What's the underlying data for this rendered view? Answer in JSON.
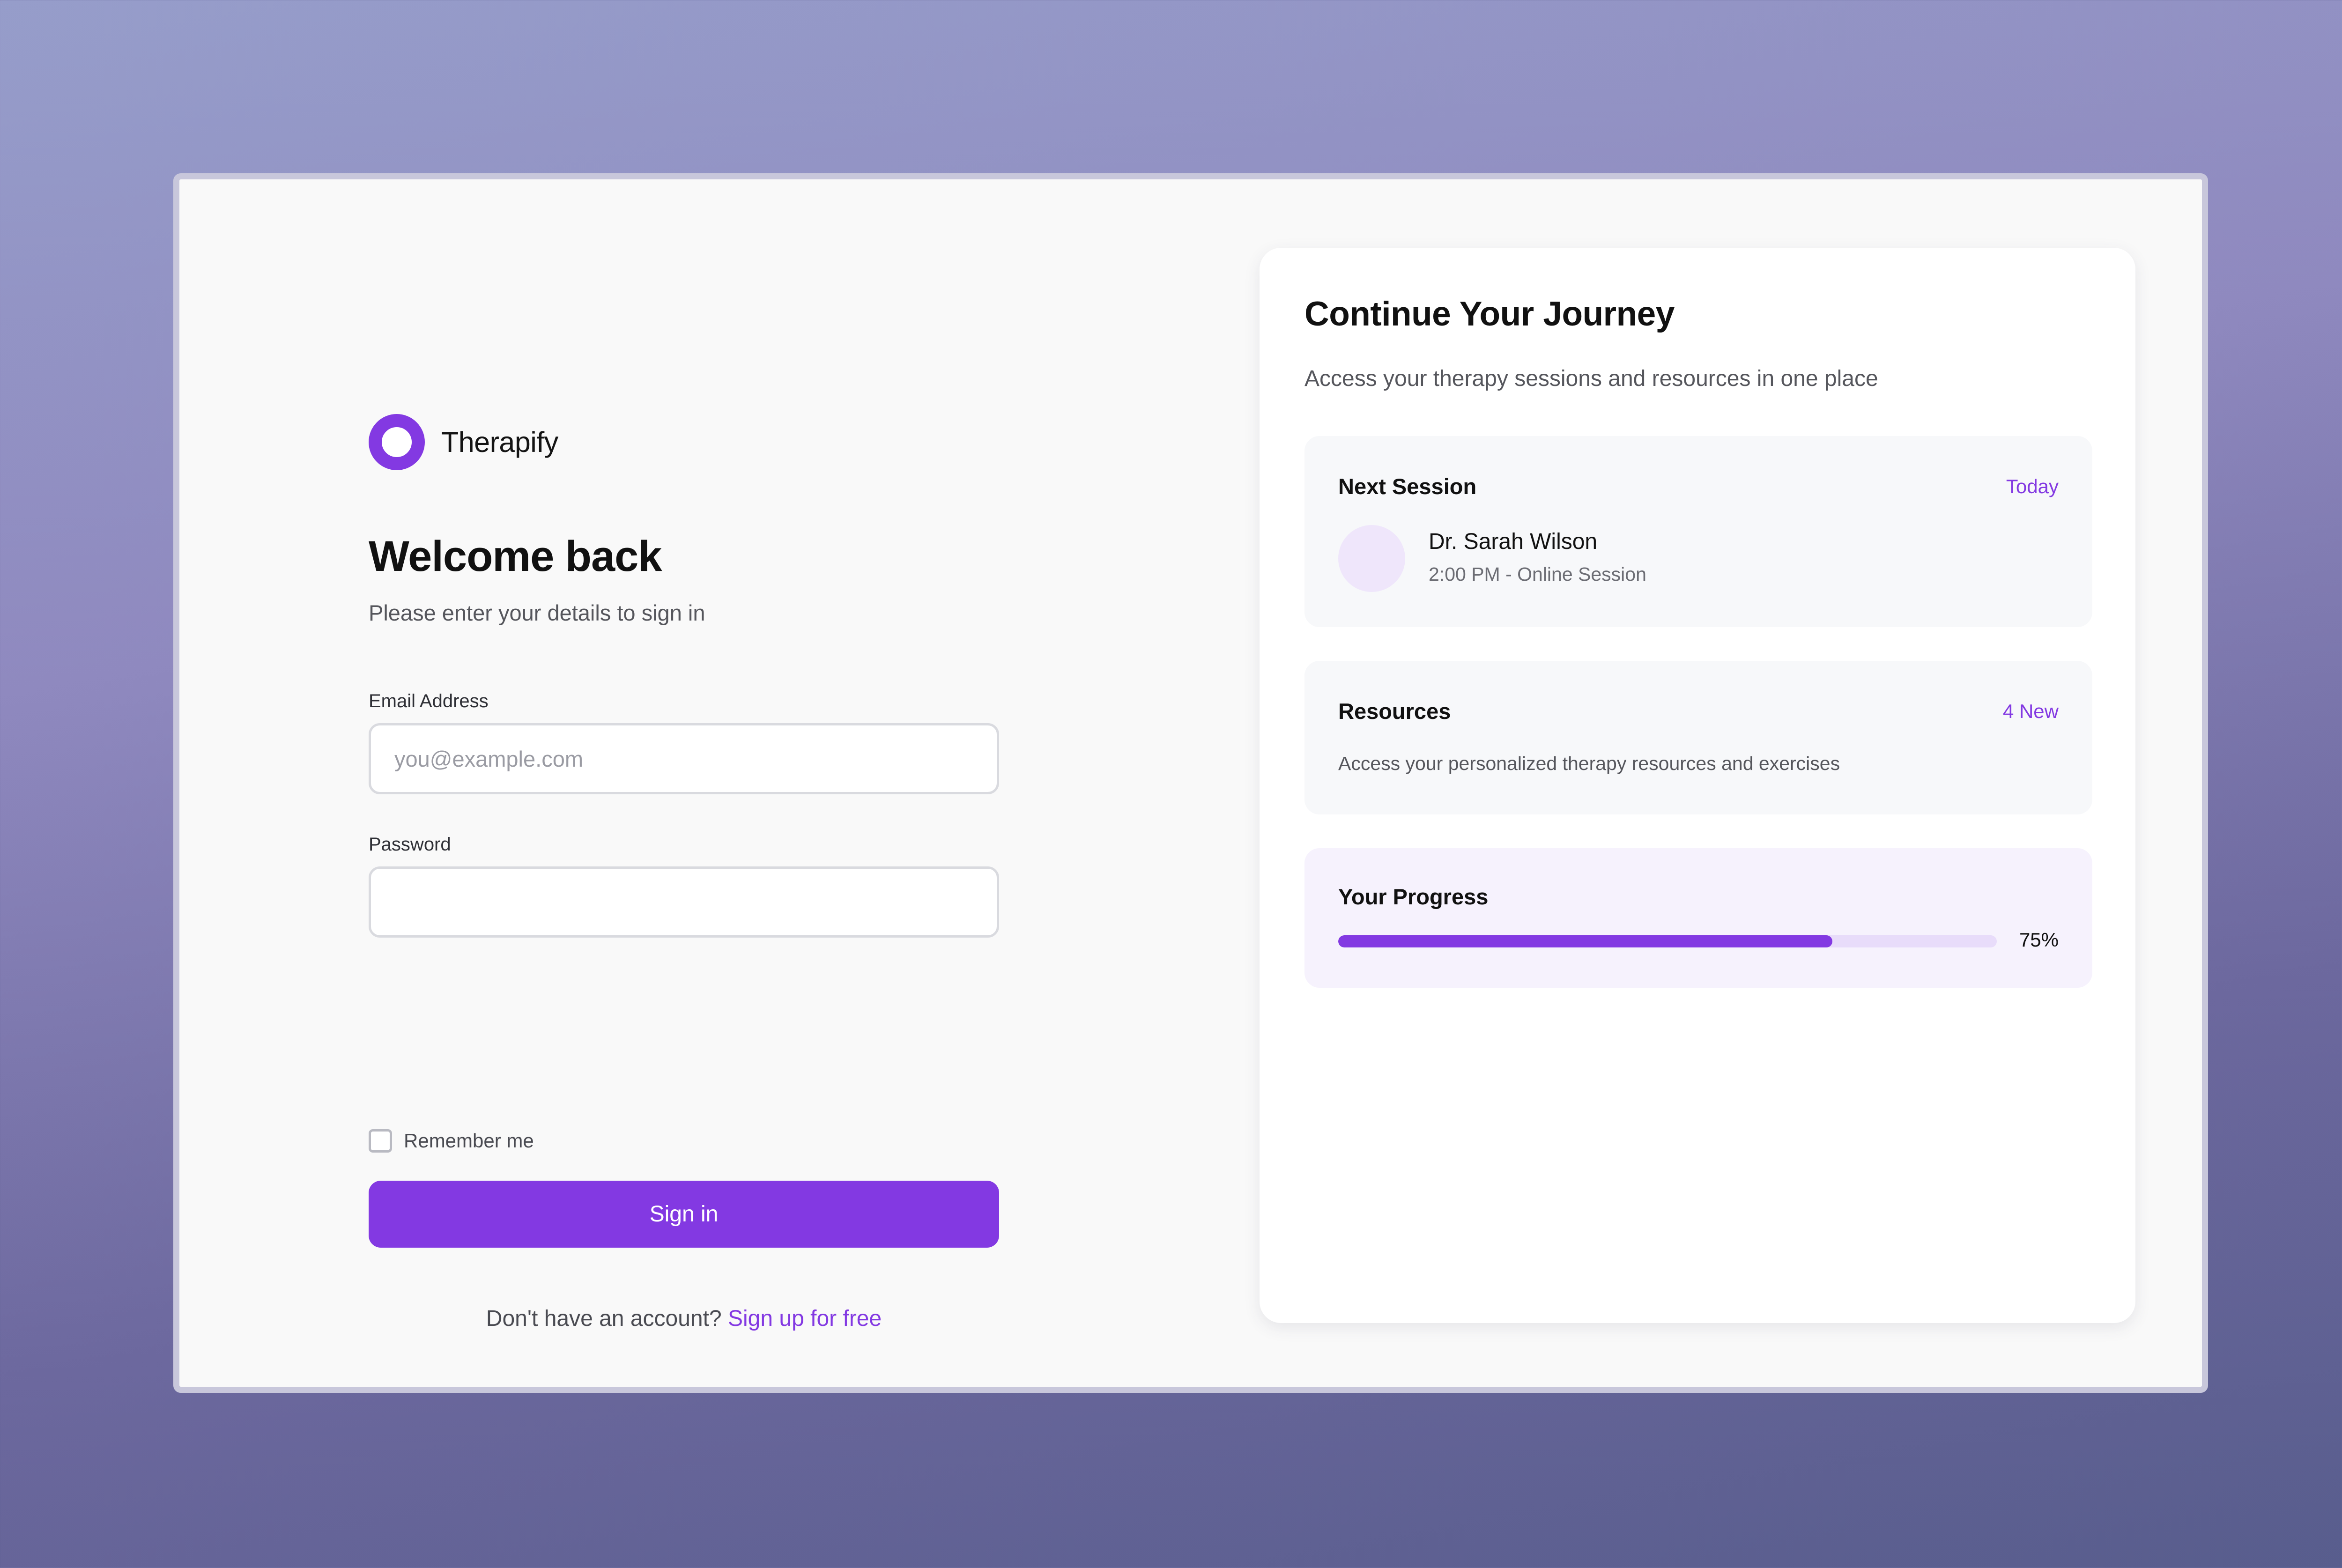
{
  "app": {
    "name": "Therapify",
    "brand_color": "#8339e2"
  },
  "login": {
    "title": "Welcome back",
    "subtitle": "Please enter your details to sign in",
    "email_label": "Email Address",
    "email_placeholder": "you@example.com",
    "email_value": "",
    "password_label": "Password",
    "password_value": "",
    "remember_label": "Remember me",
    "remember_checked": false,
    "signin_label": "Sign in",
    "signup_prompt": "Don't have an account?",
    "signup_link": "Sign up for free"
  },
  "journey": {
    "title": "Continue Your Journey",
    "subtitle": "Access your therapy sessions and resources in one place",
    "next_session": {
      "title": "Next Session",
      "badge": "Today",
      "doctor": "Dr. Sarah Wilson",
      "time": "2:00 PM - Online Session"
    },
    "resources": {
      "title": "Resources",
      "badge": "4 New",
      "description": "Access your personalized therapy resources and exercises"
    },
    "progress": {
      "title": "Your Progress",
      "percent": 75,
      "label": "75%"
    }
  }
}
